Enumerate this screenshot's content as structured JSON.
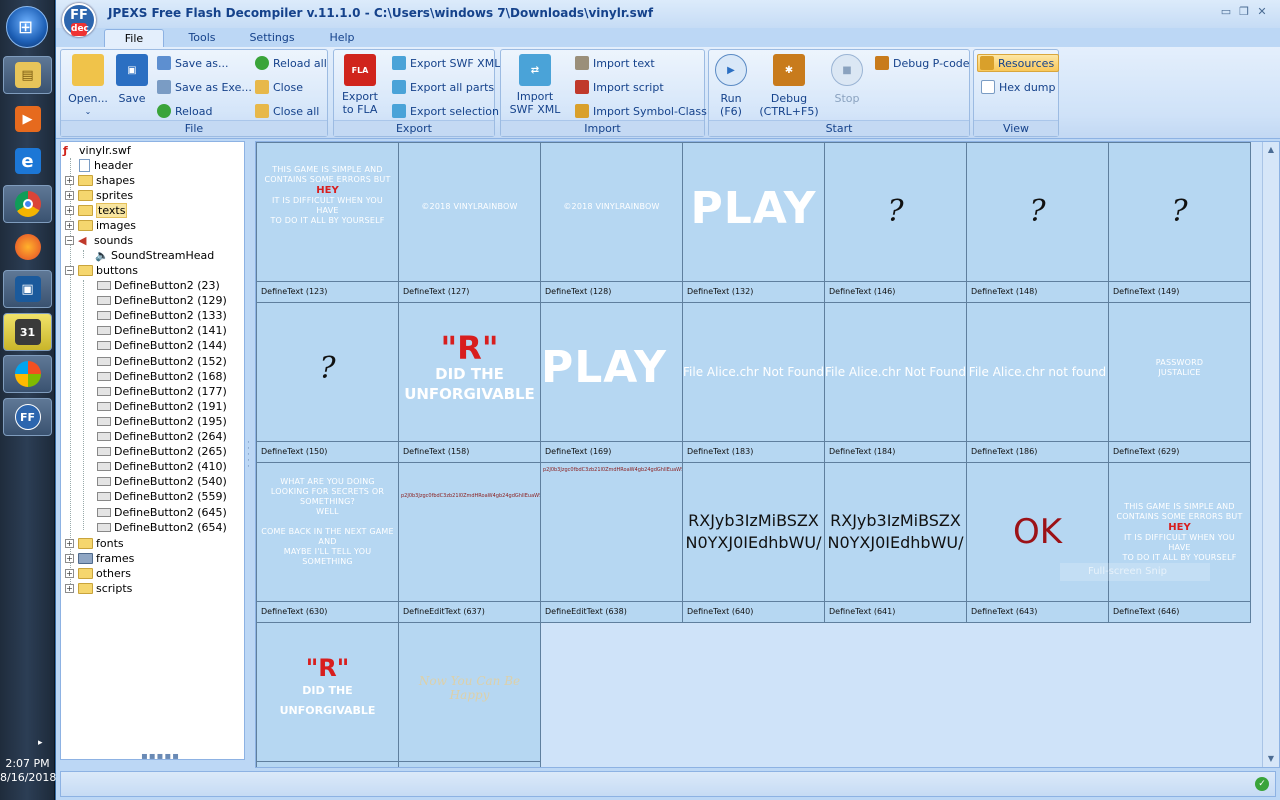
{
  "window": {
    "title": "JPEXS Free Flash Decompiler v.11.1.0 - C:\\Users\\windows 7\\Downloads\\vinylr.swf",
    "logo_text": "FF",
    "logo_sub": "dec"
  },
  "taskbar": {
    "time": "2:07 PM",
    "date": "8/16/2018"
  },
  "tabs": [
    "File",
    "Tools",
    "Settings",
    "Help"
  ],
  "ribbon": {
    "file": {
      "label": "File",
      "open": "Open...",
      "save": "Save",
      "save_as": "Save as...",
      "save_as_exe": "Save as Exe...",
      "reload": "Reload",
      "reload_all": "Reload all",
      "close": "Close",
      "close_all": "Close all"
    },
    "export": {
      "label": "Export",
      "export_fla_1": "Export",
      "export_fla_2": "to FLA",
      "export_swf_xml": "Export SWF XML",
      "export_all_parts": "Export all parts",
      "export_selection": "Export selection",
      "fla_badge": "FLA"
    },
    "import": {
      "label": "Import",
      "import_swf_xml_1": "Import",
      "import_swf_xml_2": "SWF XML",
      "import_text": "Import text",
      "import_script": "Import script",
      "import_symbol_class": "Import Symbol-Class"
    },
    "start": {
      "label": "Start",
      "run_1": "Run",
      "run_2": "(F6)",
      "debug_1": "Debug",
      "debug_2": "(CTRL+F5)",
      "stop": "Stop",
      "debug_pcode": "Debug P-code"
    },
    "view": {
      "label": "View",
      "resources": "Resources",
      "hex_dump": "Hex dump"
    }
  },
  "tree": {
    "root": "vinylr.swf",
    "header": "header",
    "shapes": "shapes",
    "sprites": "sprites",
    "texts": "texts",
    "images": "images",
    "sounds": "sounds",
    "sound_stream_head": "SoundStreamHead",
    "buttons": "buttons",
    "button_items": [
      "DefineButton2 (23)",
      "DefineButton2 (129)",
      "DefineButton2 (133)",
      "DefineButton2 (141)",
      "DefineButton2 (144)",
      "DefineButton2 (152)",
      "DefineButton2 (168)",
      "DefineButton2 (177)",
      "DefineButton2 (191)",
      "DefineButton2 (195)",
      "DefineButton2 (264)",
      "DefineButton2 (265)",
      "DefineButton2 (410)",
      "DefineButton2 (540)",
      "DefineButton2 (559)",
      "DefineButton2 (645)",
      "DefineButton2 (654)"
    ],
    "fonts": "fonts",
    "frames": "frames",
    "others": "others",
    "scripts": "scripts"
  },
  "grid": {
    "labels": [
      "DefineText (123)",
      "DefineText (127)",
      "DefineText (128)",
      "DefineText (132)",
      "DefineText (146)",
      "DefineText (148)",
      "DefineText (149)",
      "DefineText (150)",
      "DefineText (158)",
      "DefineText (169)",
      "DefineText (183)",
      "DefineText (184)",
      "DefineText (186)",
      "DefineText (629)",
      "DefineText (630)",
      "DefineEditText (637)",
      "DefineEditText (638)",
      "DefineText (640)",
      "DefineText (641)",
      "DefineText (643)",
      "DefineText (646)"
    ],
    "previews": {
      "t123_l1": "This game is simple and",
      "t123_l2": "contains some errors but",
      "t123_hey": "HEY",
      "t123_l3": "It is difficult when you have",
      "t123_l4": "to do it all by yourself",
      "t127": "©2018 VINYLRAINBOW",
      "t128": "©2018 VINYLRAINBOW",
      "t132": "PLAY",
      "t146": "?",
      "t148": "?",
      "t149": "?",
      "t150": "?",
      "t158_r": "\"R\"",
      "t158_l1": "Did the",
      "t158_l2": "unforgivable",
      "t169": "PLAY",
      "t183": "File Alice.chr Not Found",
      "t184": "File Alice.chr Not Found",
      "t186": "File Alice.chr not found",
      "t629_l1": "PASSWORD",
      "t629_l2": "JUSTALICE",
      "t630_l1": "What are you doing",
      "t630_l2": "looking for secrets or",
      "t630_l3": "something?",
      "t630_l4": "Well",
      "t630_l5": "come back in the next game",
      "t630_l6": "and",
      "t630_l7": "maybe I'll tell you something",
      "t637": "p2J0b3Jzgc0fbdC3zb21l0ZmdHRoaW4gb24gdGhlIEuaW5",
      "t638": "p2J0b3Jzgc0fbdC3zb21l0ZmdHRoaW4gb24gdGhlIEuaW5",
      "t640_l1": "RXJyb3IzMiBSZX",
      "t640_l2": "N0YXJ0IEdhbWU/",
      "t641_l1": "RXJyb3IzMiBSZX",
      "t641_l2": "N0YXJ0IEdhbWU/",
      "t643": "OK",
      "t646_l1": "This game is simple and",
      "t646_l2": "contains some errors but",
      "t646_hey": "HEY",
      "t646_l3": "It is difficult when you have",
      "t646_l4": "to do it all by yourself",
      "row4_r": "\"R\"",
      "row4_l1": "Did the unforgivable",
      "row4_faint": "Now You Can Be Happy"
    },
    "snip_overlay": "Full-screen Snip"
  }
}
